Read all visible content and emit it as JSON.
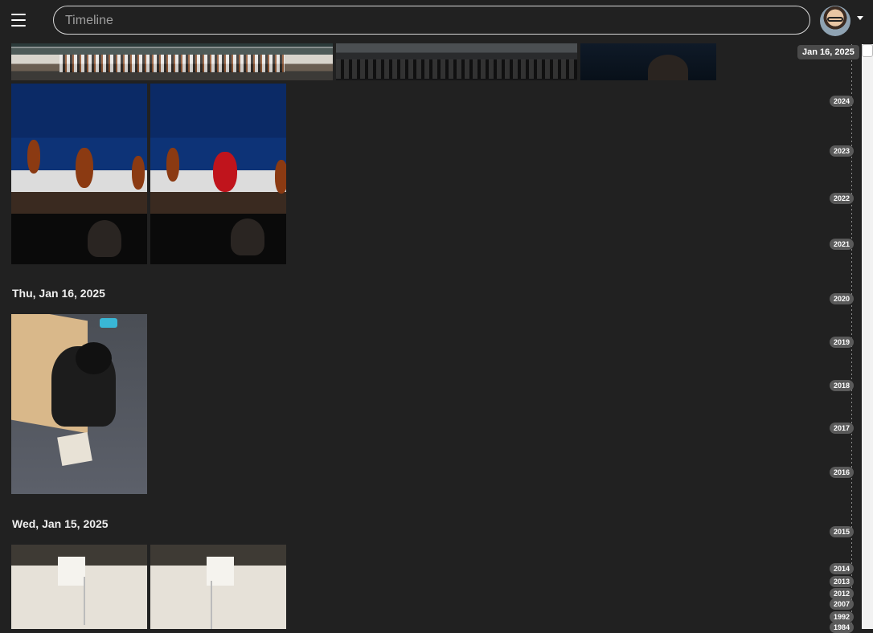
{
  "header": {
    "search_placeholder": "Timeline"
  },
  "sections": [
    {
      "date": "Thu, Jan 16, 2025"
    },
    {
      "date": "Wed, Jan 15, 2025"
    }
  ],
  "scrubber": {
    "current_date": "Jan 16, 2025",
    "years": [
      "2024",
      "2023",
      "2022",
      "2021",
      "2020",
      "2019",
      "2018",
      "2017",
      "2016",
      "2015",
      "2014",
      "2013",
      "2012",
      "2007",
      "1992",
      "1984"
    ]
  }
}
